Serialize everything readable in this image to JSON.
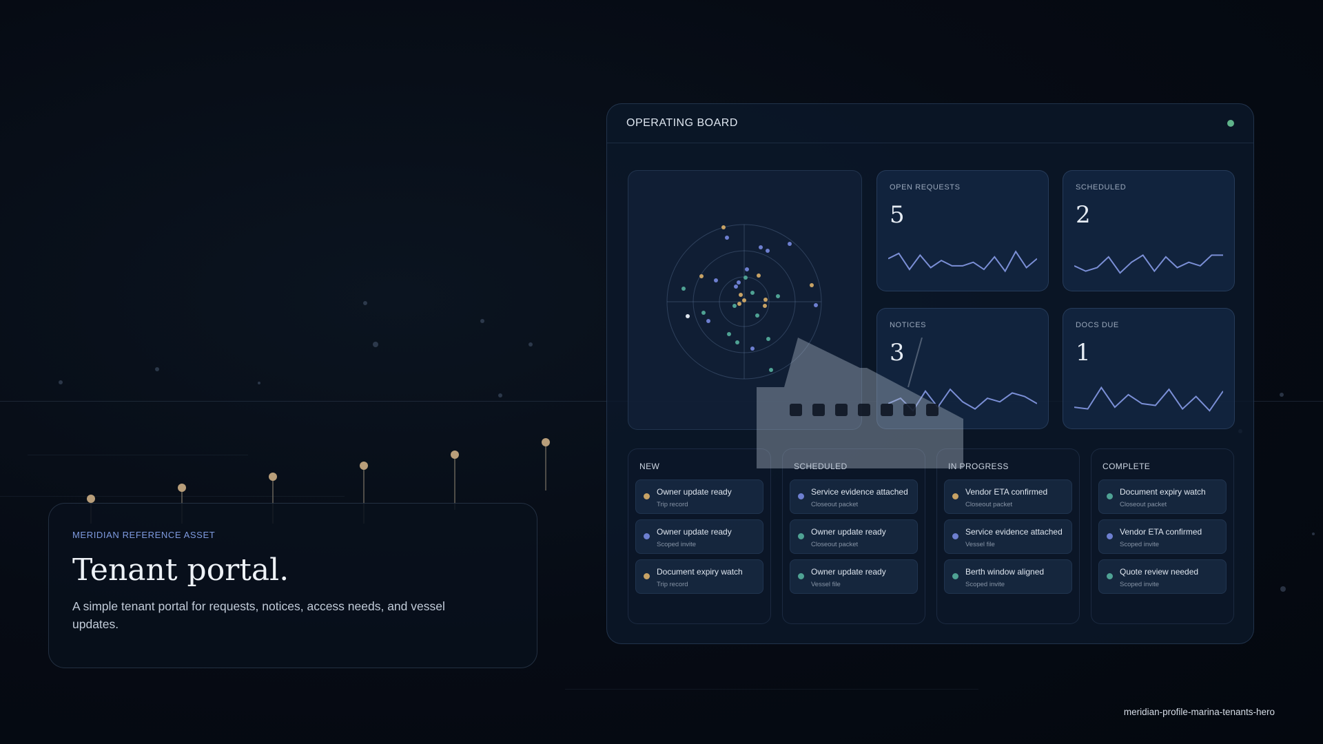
{
  "board": {
    "title": "OPERATING BOARD",
    "status_color": "#5fb38a",
    "metrics": [
      {
        "label": "OPEN REQUESTS",
        "value": "5",
        "trend": [
          22,
          28,
          10,
          26,
          12,
          20,
          14,
          14,
          18,
          10,
          24,
          8,
          30,
          12,
          22
        ]
      },
      {
        "label": "SCHEDULED",
        "value": "2",
        "trend": [
          14,
          8,
          12,
          24,
          6,
          18,
          26,
          8,
          24,
          12,
          18,
          14,
          26,
          26
        ]
      },
      {
        "label": "NOTICES",
        "value": "3",
        "trend": [
          14,
          20,
          6,
          28,
          10,
          30,
          16,
          8,
          20,
          16,
          26,
          22,
          14
        ]
      },
      {
        "label": "DOCS DUE",
        "value": "1",
        "trend": [
          10,
          8,
          32,
          10,
          24,
          14,
          12,
          30,
          8,
          22,
          6,
          28
        ]
      }
    ],
    "columns": [
      {
        "title": "NEW",
        "tasks": [
          {
            "title": "Owner update ready",
            "sub": "Trip record",
            "color": "#c7a265"
          },
          {
            "title": "Owner update ready",
            "sub": "Scoped invite",
            "color": "#6d7fd0"
          },
          {
            "title": "Document expiry watch",
            "sub": "Trip record",
            "color": "#c7a265"
          }
        ]
      },
      {
        "title": "SCHEDULED",
        "tasks": [
          {
            "title": "Service evidence attached",
            "sub": "Closeout packet",
            "color": "#6d7fd0"
          },
          {
            "title": "Owner update ready",
            "sub": "Closeout packet",
            "color": "#4fa294"
          },
          {
            "title": "Owner update ready",
            "sub": "Vessel file",
            "color": "#4fa294"
          }
        ]
      },
      {
        "title": "IN PROGRESS",
        "tasks": [
          {
            "title": "Vendor ETA confirmed",
            "sub": "Closeout packet",
            "color": "#c7a265"
          },
          {
            "title": "Service evidence attached",
            "sub": "Vessel file",
            "color": "#6d7fd0"
          },
          {
            "title": "Berth window aligned",
            "sub": "Scoped invite",
            "color": "#4fa294"
          }
        ]
      },
      {
        "title": "COMPLETE",
        "tasks": [
          {
            "title": "Document expiry watch",
            "sub": "Closeout packet",
            "color": "#4fa294"
          },
          {
            "title": "Vendor ETA confirmed",
            "sub": "Scoped invite",
            "color": "#6d7fd0"
          },
          {
            "title": "Quote review needed",
            "sub": "Scoped invite",
            "color": "#4fa294"
          }
        ]
      }
    ]
  },
  "hero": {
    "kicker": "MERIDIAN REFERENCE ASSET",
    "title": "Tenant portal.",
    "description": "A simple tenant portal for requests, notices, access needs, and vessel updates."
  },
  "asset_id": "meridian-profile-marina-tenants-hero",
  "colors": {
    "gold": "#c7a265",
    "blue": "#6d7fd0",
    "teal": "#4fa294",
    "line": "#7b8fd6"
  }
}
